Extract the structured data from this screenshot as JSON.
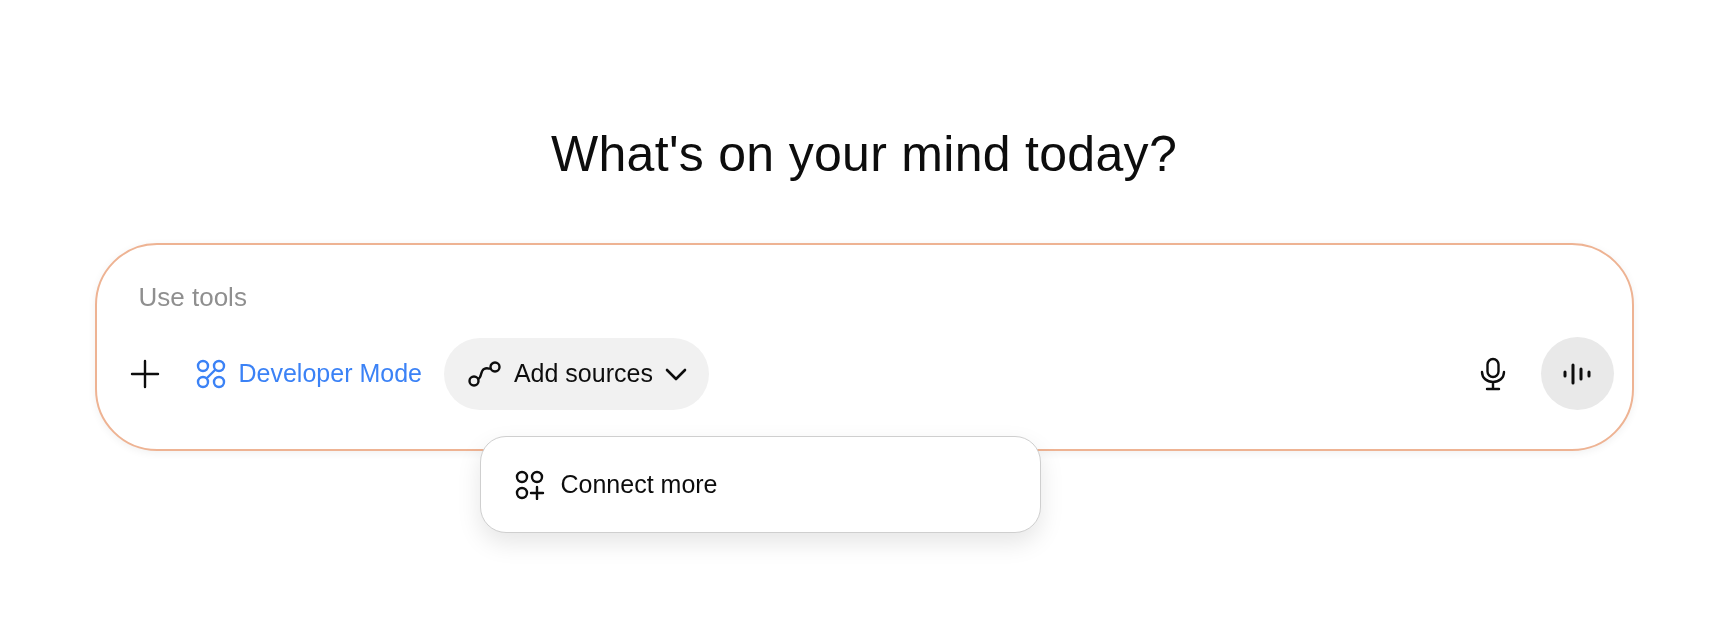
{
  "heading": "What's on your mind today?",
  "composer": {
    "placeholder": "Use tools",
    "developer_mode": {
      "label": "Developer Mode",
      "active": true
    },
    "add_sources": {
      "label": "Add sources",
      "expanded": true
    },
    "menu": [
      {
        "label": "Connect more"
      }
    ]
  }
}
